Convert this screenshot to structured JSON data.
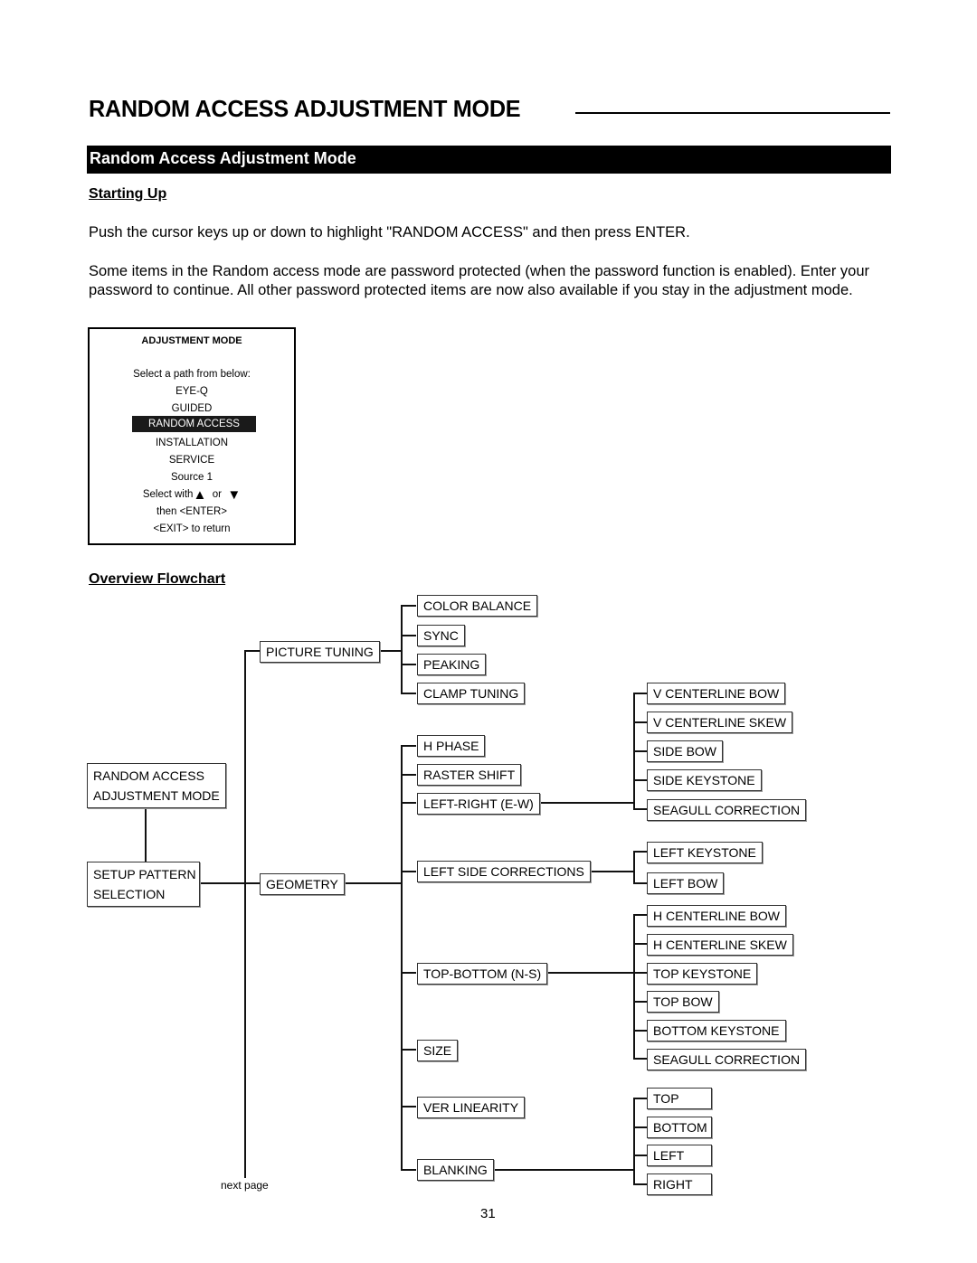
{
  "page": {
    "title": "RANDOM ACCESS ADJUSTMENT MODE",
    "section_header": "Random Access Adjustment Mode",
    "starting_up": {
      "heading": "Starting Up",
      "para1": "Push the cursor keys up or down to highlight \"RANDOM ACCESS\"  and then press ENTER.",
      "para2": "Some items in the Random access mode are password protected (when the password function is enabled). Enter your password to continue. All other password protected items are now also available if you stay in the adjustment mode."
    },
    "page_number": "31"
  },
  "osd_menu": {
    "title": "ADJUSTMENT MODE",
    "prompt": "Select a path from below:",
    "items": [
      "EYE-Q",
      "GUIDED",
      "RANDOM ACCESS",
      "INSTALLATION",
      "SERVICE"
    ],
    "selected": "RANDOM ACCESS",
    "source": "Source 1",
    "select_with": "Select with",
    "or": "or",
    "up_icon": "▲",
    "down_icon": "▼",
    "then_enter": "then <ENTER>",
    "exit": "<EXIT> to return"
  },
  "flowchart": {
    "heading": "Overview Flowchart",
    "root": "RANDOM ACCESS\nADJUSTMENT MODE",
    "root_lines": [
      "RANDOM ACCESS",
      "ADJUSTMENT MODE"
    ],
    "setup": [
      "SETUP PATTERN",
      "SELECTION"
    ],
    "next_page": "next page",
    "picture_tuning": {
      "label": "PICTURE TUNING",
      "children": [
        "COLOR BALANCE",
        "SYNC",
        "PEAKING",
        "CLAMP TUNING"
      ]
    },
    "geometry": {
      "label": "GEOMETRY",
      "children": {
        "h_phase": "H PHASE",
        "raster_shift": "RASTER SHIFT",
        "left_right": {
          "label": "LEFT-RIGHT (E-W)",
          "children": [
            "V CENTERLINE BOW",
            "V CENTERLINE SKEW",
            "SIDE BOW",
            "SIDE KEYSTONE",
            "SEAGULL CORRECTION"
          ]
        },
        "left_side": {
          "label": "LEFT SIDE CORRECTIONS",
          "children": [
            "LEFT KEYSTONE",
            "LEFT BOW"
          ]
        },
        "top_bottom": {
          "label": "TOP-BOTTOM (N-S)",
          "children": [
            "H CENTERLINE BOW",
            "H CENTERLINE SKEW",
            "TOP KEYSTONE",
            "TOP BOW",
            "BOTTOM KEYSTONE",
            "SEAGULL CORRECTION"
          ]
        },
        "size": "SIZE",
        "ver_linearity": "VER LINEARITY",
        "blanking": {
          "label": "BLANKING",
          "children": [
            "TOP",
            "BOTTOM",
            "LEFT",
            "RIGHT"
          ]
        }
      }
    }
  }
}
